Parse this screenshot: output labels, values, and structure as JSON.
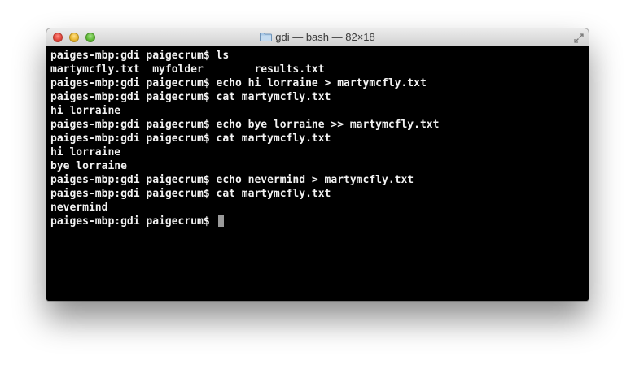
{
  "window": {
    "title": "gdi — bash — 82×18"
  },
  "terminal": {
    "lines": [
      "paiges-mbp:gdi paigecrum$ ls",
      "martymcfly.txt  myfolder        results.txt",
      "paiges-mbp:gdi paigecrum$ echo hi lorraine > martymcfly.txt",
      "paiges-mbp:gdi paigecrum$ cat martymcfly.txt",
      "hi lorraine",
      "paiges-mbp:gdi paigecrum$ echo bye lorraine >> martymcfly.txt",
      "paiges-mbp:gdi paigecrum$ cat martymcfly.txt",
      "hi lorraine",
      "bye lorraine",
      "paiges-mbp:gdi paigecrum$ echo nevermind > martymcfly.txt",
      "paiges-mbp:gdi paigecrum$ cat martymcfly.txt",
      "nevermind"
    ],
    "prompt": "paiges-mbp:gdi paigecrum$ "
  }
}
